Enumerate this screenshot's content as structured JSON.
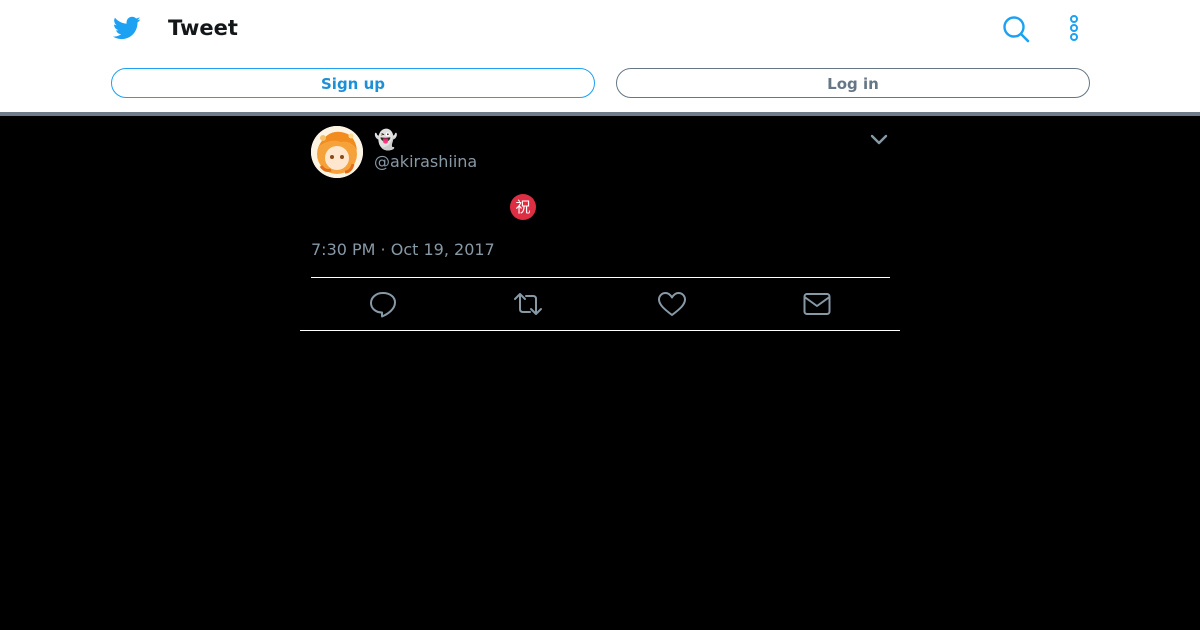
{
  "header": {
    "title": "Tweet",
    "signup_label": "Sign up",
    "login_label": "Log in"
  },
  "tweet": {
    "display_name": "👻",
    "handle": "@akirashiina",
    "body_emoji": "祝",
    "timestamp": "7:30 PM · Oct 19, 2017"
  },
  "icons": {
    "brand": "twitter-bird-icon",
    "search": "search-icon",
    "more": "more-vertical-icon",
    "menu": "chevron-down-icon",
    "reply": "reply-icon",
    "retweet": "retweet-icon",
    "like": "like-heart-icon",
    "message": "envelope-icon"
  },
  "colors": {
    "brand_blue": "#1da1f2",
    "muted_gray": "#657786",
    "background": "#000000",
    "emoji_red": "#dd2e44"
  }
}
